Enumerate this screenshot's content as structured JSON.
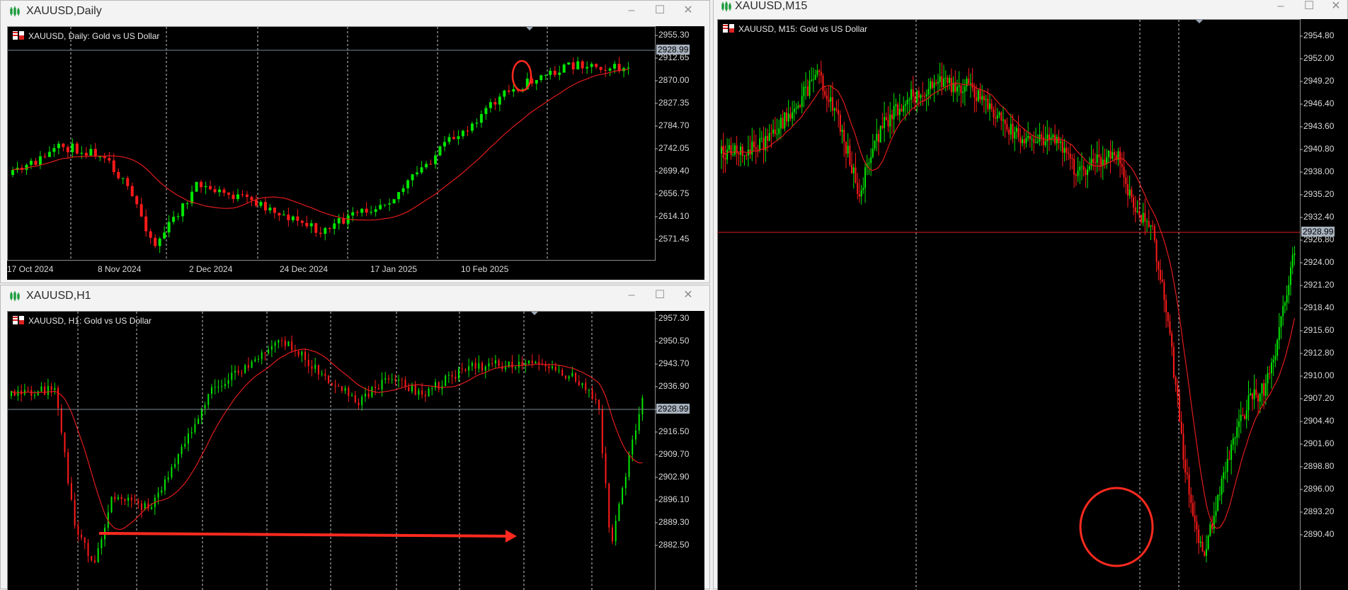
{
  "windows": {
    "daily": {
      "title": "XAUUSD,Daily",
      "header": "XAUUSD, Daily:  Gold vs US Dollar",
      "price_labels": [
        "2955.30",
        "2912.65",
        "2870.00",
        "2827.35",
        "2784.70",
        "2742.05",
        "2699.40",
        "2656.75",
        "2614.10",
        "2571.45"
      ],
      "current_price": "2928.99",
      "date_labels": [
        "17 Oct 2024",
        "8 Nov 2024",
        "2 Dec 2024",
        "24 Dec 2024",
        "17 Jan 2025",
        "10 Feb 2025"
      ]
    },
    "h1": {
      "title": "XAUUSD,H1",
      "header": "XAUUSD, H1:  Gold vs US Dollar",
      "price_labels": [
        "2957.30",
        "2950.50",
        "2943.70",
        "2936.90",
        "2923.30",
        "2916.50",
        "2909.70",
        "2902.90",
        "2896.10",
        "2889.30",
        "2882.50"
      ],
      "current_price": "2928.99"
    },
    "m15": {
      "title": "XAUUSD,M15",
      "header": "XAUUSD, M15:  Gold vs US Dollar",
      "price_labels": [
        "2954.80",
        "2952.00",
        "2949.20",
        "2946.40",
        "2943.60",
        "2940.80",
        "2938.00",
        "2935.20",
        "2932.40",
        "2926.80",
        "2924.00",
        "2921.20",
        "2918.40",
        "2915.60",
        "2912.80",
        "2910.00",
        "2907.20",
        "2904.40",
        "2901.60",
        "2898.80",
        "2896.00",
        "2893.20",
        "2890.40"
      ],
      "current_price": "2928.99"
    }
  },
  "colors": {
    "bull": "#00e600",
    "bear": "#ff1a1a",
    "ma": "#e11b1b",
    "annotation": "#ff2a1f"
  },
  "icons": {
    "window": "chart-bars-icon",
    "minimize": "minimize-icon",
    "maximize": "maximize-icon",
    "close": "close-icon"
  }
}
